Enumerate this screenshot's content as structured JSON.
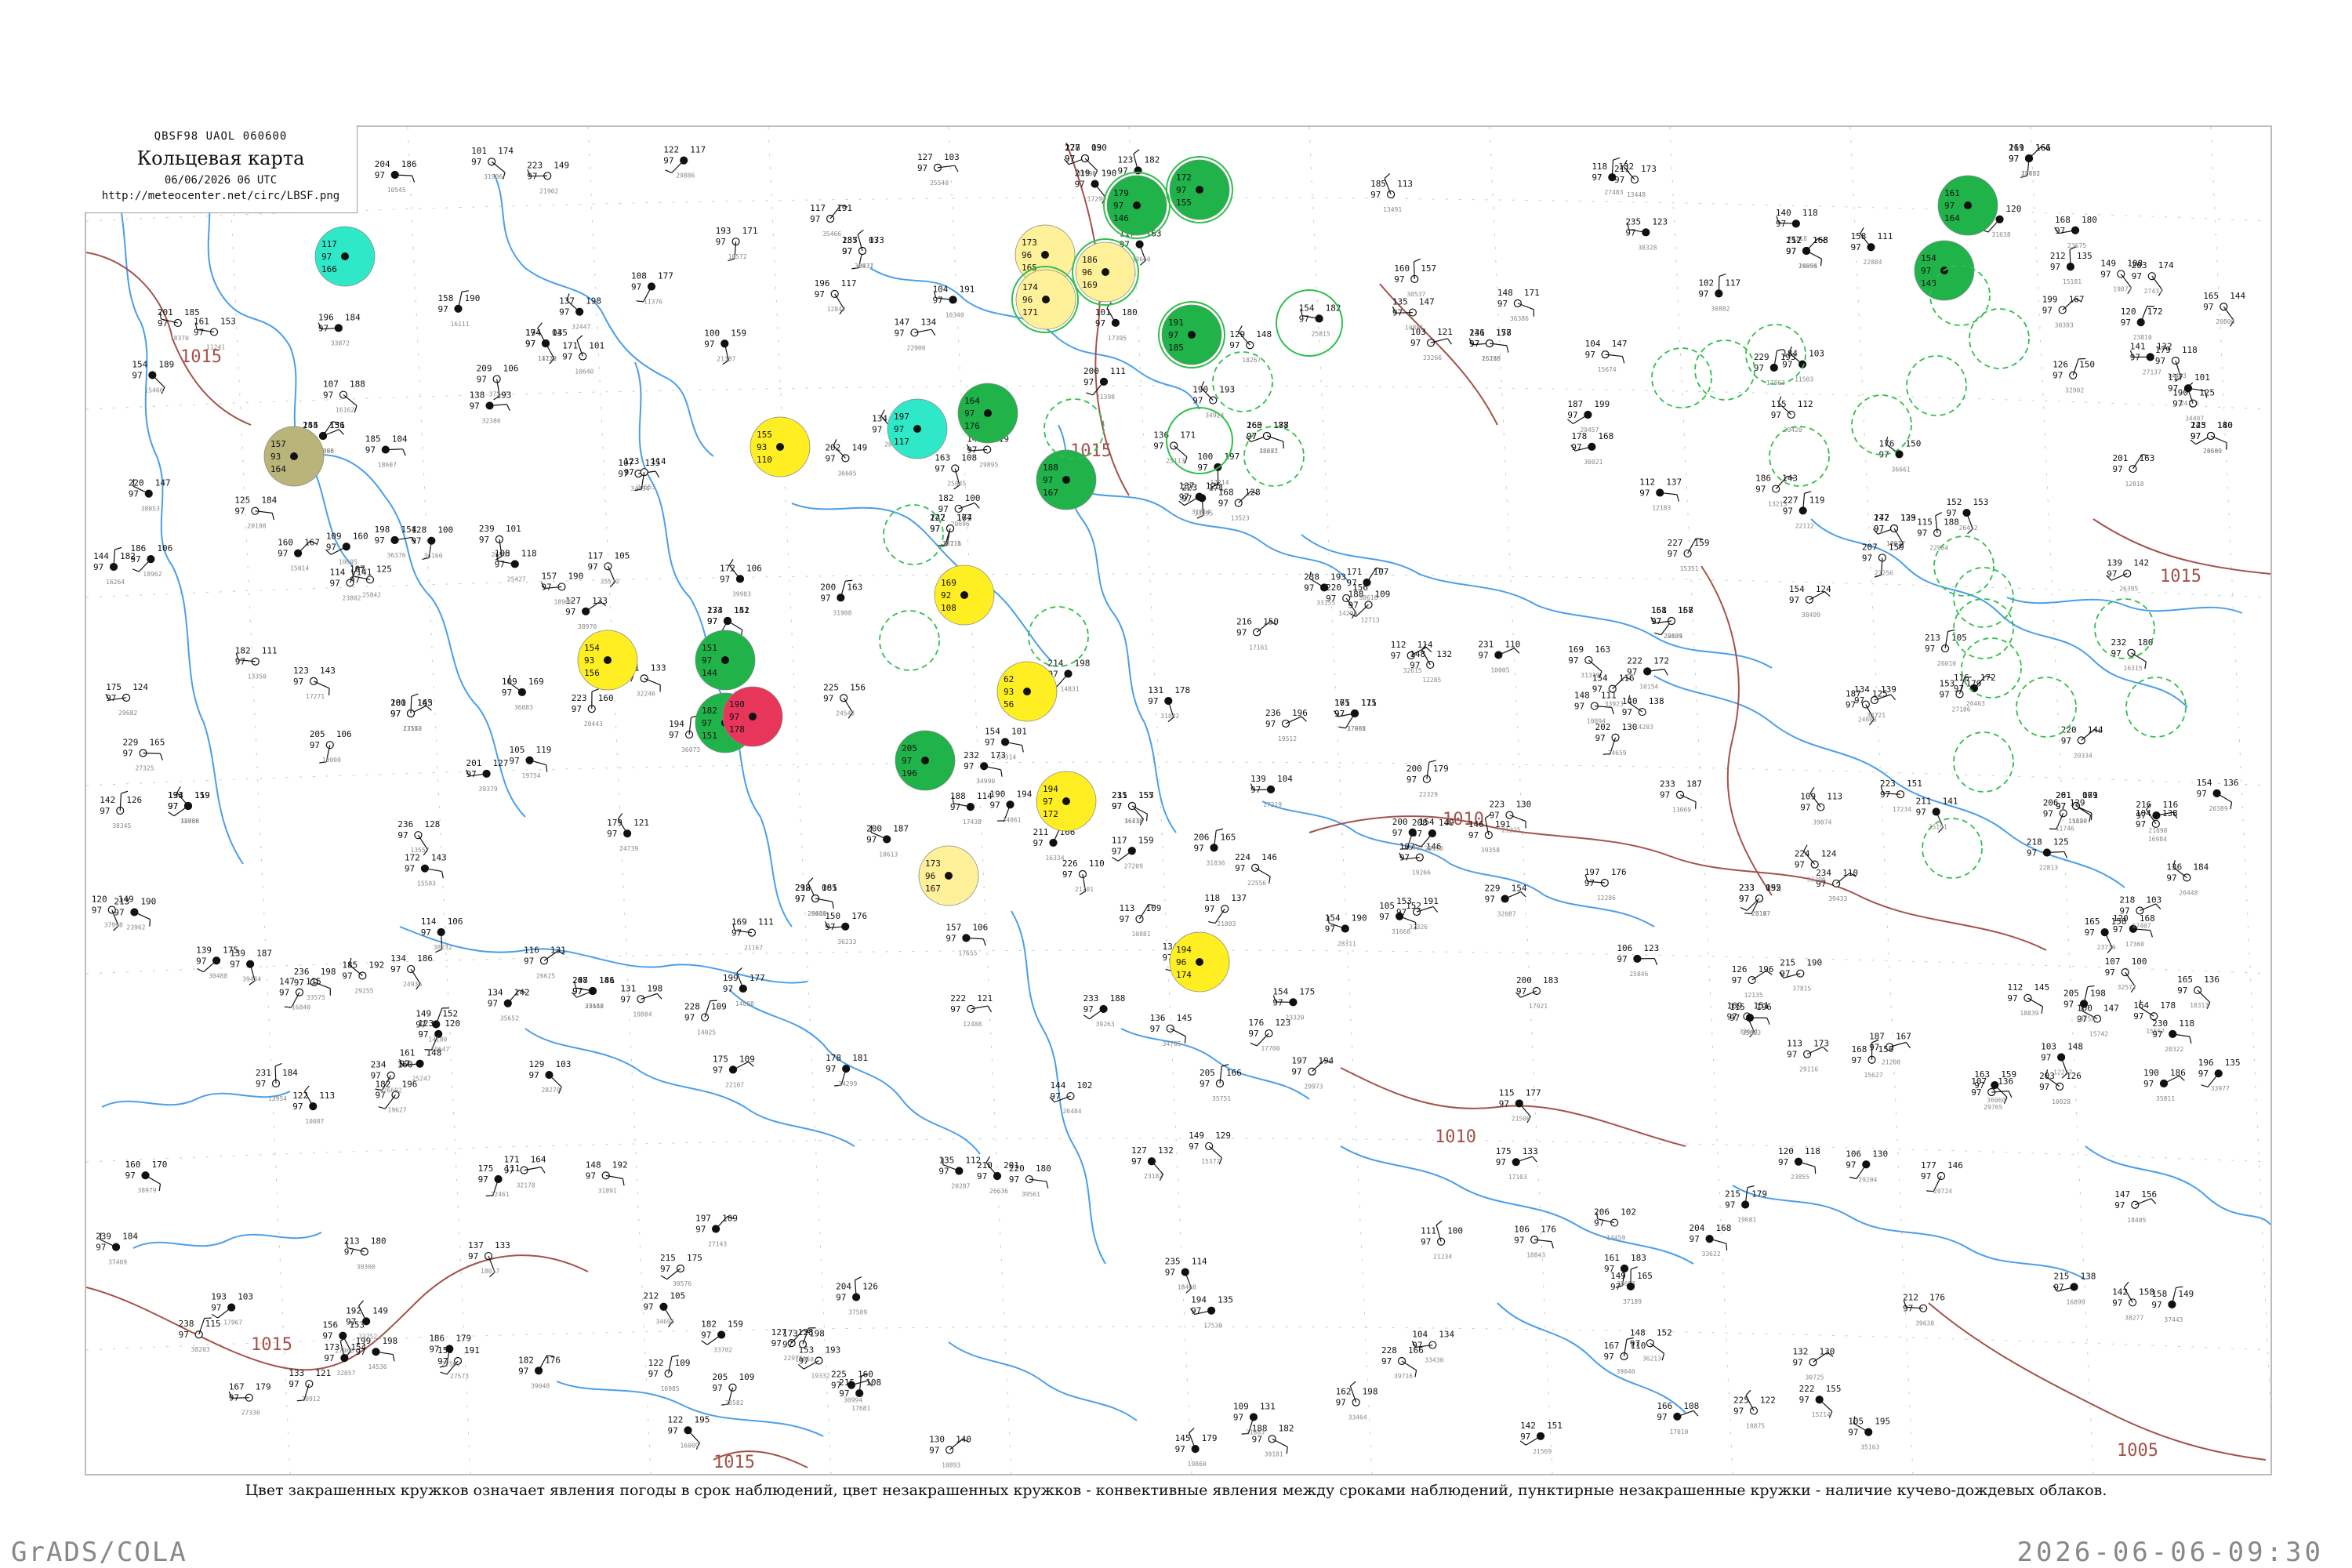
{
  "header": {
    "code": "QBSF98  UAOL  060600",
    "title": "Кольцевая карта",
    "time": "06/06/2026 06 UTC",
    "url": "http://meteocenter.net/circ/LBSF.png"
  },
  "caption": "Цвет закрашенных кружков означает явления погоды в срок наблюдений, цвет незакрашенных кружков - конвективные явления между сроками наблюдений, пунктирные незакрашенные кружки - наличие кучево-дождевых облаков.",
  "footer": {
    "left": "GrADS/COLA",
    "right": "2026-06-06-09:30"
  },
  "colors": {
    "coast": "#4a9fe8",
    "isobar": "#a3524a",
    "station": "#111111",
    "rain_green": "#1fb34a",
    "cb_dashed": "#2fbf4a",
    "yellow": "#ffee22",
    "pale_yellow": "#fff09a",
    "cyan": "#2fe8c8",
    "red": "#e8355a",
    "olive": "#b8b47a"
  },
  "isobar_labels": [
    "1015",
    "1015",
    "1015",
    "1010",
    "1010",
    "1005",
    "1015",
    "1015"
  ],
  "stations": [
    {
      "top": "146",
      "left": "97",
      "right": "164"
    },
    {
      "top": "178",
      "left": "97",
      "right": "03"
    },
    {
      "top": "161",
      "left": "97",
      "right": "161"
    },
    {
      "top": "187",
      "left": "97",
      "right": "03"
    },
    {
      "top": "157",
      "left": "97",
      "right": "165"
    },
    {
      "top": "174",
      "left": "97",
      "right": "03"
    },
    {
      "top": "131",
      "left": "97",
      "right": "178"
    },
    {
      "top": "144",
      "left": "97",
      "right": "136"
    },
    {
      "top": "160",
      "left": "97",
      "right": "177"
    },
    {
      "top": "143",
      "left": "97",
      "right": "180"
    },
    {
      "top": "147",
      "left": "97",
      "right": "174"
    },
    {
      "top": "172",
      "left": "97",
      "right": "129"
    },
    {
      "top": "174",
      "left": "97",
      "right": "141"
    },
    {
      "top": "158",
      "left": "97",
      "right": "167"
    },
    {
      "top": "180",
      "left": "97",
      "right": "163"
    },
    {
      "top": "161",
      "left": "97",
      "right": "171"
    },
    {
      "top": "133",
      "left": "97",
      "right": "119"
    },
    {
      "top": "215",
      "left": "97",
      "right": "157"
    },
    {
      "top": "201",
      "left": "97",
      "right": "161"
    },
    {
      "top": "218",
      "left": "97",
      "right": "165"
    },
    {
      "top": "233",
      "left": "97",
      "right": "155"
    },
    {
      "top": "208",
      "left": "97",
      "right": "181"
    },
    {
      "top": "200",
      "left": "97",
      "right": "183"
    },
    {
      "top": "231",
      "left": "97",
      "right": "184"
    },
    {
      "top": "205",
      "left": "97",
      "right": "166"
    },
    {
      "top": "190",
      "left": "97",
      "right": "186"
    },
    {
      "top": "210",
      "left": "97",
      "right": "201"
    },
    {
      "top": "177",
      "left": "97",
      "right": "146"
    },
    {
      "top": "215",
      "left": "97",
      "right": "175"
    },
    {
      "top": "161",
      "left": "97",
      "right": "183"
    },
    {
      "top": "155",
      "left": "97",
      "right": "191"
    },
    {
      "top": "228",
      "left": "97",
      "right": "166"
    },
    {
      "top": "201",
      "left": "97",
      "right": "156"
    },
    {
      "top": "227",
      "left": "97",
      "right": "190"
    },
    {
      "top": "219",
      "left": "97",
      "right": "166"
    },
    {
      "top": "235",
      "left": "97",
      "right": "173"
    },
    {
      "top": "212",
      "left": "97",
      "right": "168"
    },
    {
      "top": "194",
      "left": "97",
      "right": "145"
    },
    {
      "top": "246",
      "left": "97",
      "right": "157"
    },
    {
      "top": "255",
      "left": "97",
      "right": "151"
    },
    {
      "top": "263",
      "left": "97",
      "right": "188"
    },
    {
      "top": "225",
      "left": "97",
      "right": "140"
    },
    {
      "top": "222",
      "left": "97",
      "right": "167"
    },
    {
      "top": "247",
      "left": "97",
      "right": "133"
    },
    {
      "top": "233",
      "left": "97",
      "right": "152"
    },
    {
      "top": "161",
      "left": "97",
      "right": "158"
    },
    {
      "top": "201",
      "left": "97",
      "right": "145"
    },
    {
      "top": "175",
      "left": "97",
      "right": "115"
    },
    {
      "top": "194",
      "left": "97",
      "right": "159"
    },
    {
      "top": "231",
      "left": "97",
      "right": "155"
    },
    {
      "top": "261",
      "left": "97",
      "right": "079"
    },
    {
      "top": "292",
      "left": "97",
      "right": "081"
    },
    {
      "top": "233",
      "left": "97",
      "right": "092"
    },
    {
      "top": "247",
      "left": "97",
      "right": "146"
    }
  ],
  "filled_circles": [
    {
      "top": "117",
      "mid": "97",
      "low": "166",
      "color": "cyan"
    },
    {
      "top": "157",
      "mid": "93",
      "low": "164",
      "color": "olive"
    },
    {
      "top": "155",
      "mid": "93",
      "low": "110",
      "color": "yellow"
    },
    {
      "top": "154",
      "mid": "93",
      "low": "156",
      "color": "yellow"
    },
    {
      "top": "151",
      "mid": "97",
      "low": "144",
      "color": "green"
    },
    {
      "top": "182",
      "mid": "97",
      "low": "151",
      "color": "green"
    },
    {
      "top": "190",
      "mid": "97",
      "low": "178",
      "color": "red"
    },
    {
      "top": "197",
      "mid": "97",
      "low": "117",
      "color": "cyan"
    },
    {
      "top": "164",
      "mid": "97",
      "low": "176",
      "color": "green"
    },
    {
      "top": "205",
      "mid": "97",
      "low": "196",
      "color": "green"
    },
    {
      "top": "169",
      "mid": "92",
      "low": "108",
      "color": "yellow"
    },
    {
      "top": "62",
      "mid": "93",
      "low": "56",
      "color": "yellow"
    },
    {
      "top": "194",
      "mid": "97",
      "low": "172",
      "color": "yellow"
    },
    {
      "top": "173",
      "mid": "96",
      "low": "167",
      "color": "pale_yellow"
    },
    {
      "top": "194",
      "mid": "96",
      "low": "174",
      "color": "yellow"
    },
    {
      "top": "173",
      "mid": "96",
      "low": "165",
      "color": "pale_yellow"
    },
    {
      "top": "174",
      "mid": "96",
      "low": "171",
      "color": "pale_yellow"
    },
    {
      "top": "186",
      "mid": "96",
      "low": "169",
      "color": "pale_yellow"
    },
    {
      "top": "179",
      "mid": "97",
      "low": "146",
      "color": "green"
    },
    {
      "top": "172",
      "mid": "97",
      "low": "155",
      "color": "green"
    },
    {
      "top": "191",
      "mid": "97",
      "low": "185",
      "color": "green"
    },
    {
      "top": "188",
      "mid": "97",
      "low": "167",
      "color": "green"
    },
    {
      "top": "154",
      "mid": "97",
      "low": "148",
      "color": "green"
    },
    {
      "top": "161",
      "mid": "97",
      "low": "164",
      "color": "green"
    }
  ]
}
